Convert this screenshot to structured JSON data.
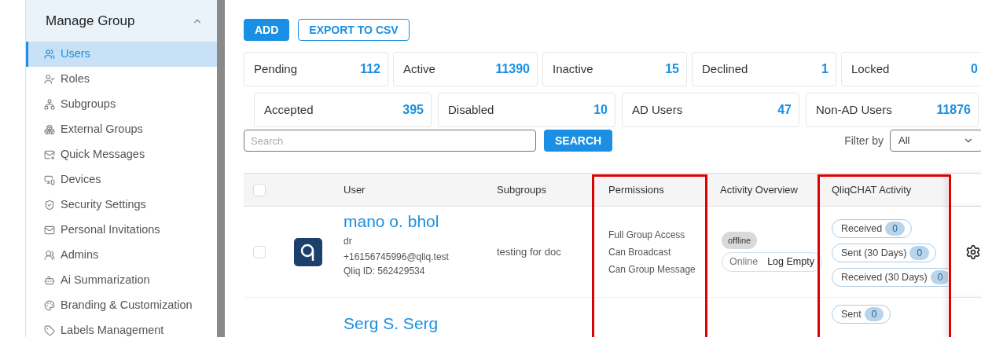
{
  "sidebar": {
    "title": "Manage Group",
    "expanded": true,
    "items": [
      {
        "label": "Users",
        "selected": true
      },
      {
        "label": "Roles",
        "selected": false
      },
      {
        "label": "Subgroups",
        "selected": false
      },
      {
        "label": "External Groups",
        "selected": false
      },
      {
        "label": "Quick Messages",
        "selected": false
      },
      {
        "label": "Devices",
        "selected": false
      },
      {
        "label": "Security Settings",
        "selected": false
      },
      {
        "label": "Personal Invitations",
        "selected": false
      },
      {
        "label": "Admins",
        "selected": false
      },
      {
        "label": "Ai Summarization",
        "selected": false
      },
      {
        "label": "Branding & Customization",
        "selected": false
      },
      {
        "label": "Labels Management",
        "selected": false
      }
    ]
  },
  "actions": {
    "add": "ADD",
    "export": "EXPORT TO CSV"
  },
  "stats_row_1": [
    {
      "label": "Pending",
      "count": "112"
    },
    {
      "label": "Active",
      "count": "11390"
    },
    {
      "label": "Inactive",
      "count": "15"
    },
    {
      "label": "Declined",
      "count": "1"
    },
    {
      "label": "Locked",
      "count": "0"
    }
  ],
  "stats_row_2": [
    {
      "label": "Accepted",
      "count": "395"
    },
    {
      "label": "Disabled",
      "count": "10"
    },
    {
      "label": "AD Users",
      "count": "47"
    },
    {
      "label": "Non-AD Users",
      "count": "11876"
    }
  ],
  "search": {
    "placeholder": "Search",
    "button": "SEARCH"
  },
  "filter": {
    "label": "Filter by",
    "value": "All"
  },
  "table": {
    "select_all_checked": false,
    "columns": [
      "User",
      "Subgroups",
      "Permissions",
      "Activity Overview",
      "QliqCHAT Activity"
    ],
    "rows": [
      {
        "name": "mano o. bhol",
        "title": "dr",
        "email": "+16156745996@qliq.test",
        "qliq_id": "Qliq ID: 562429534",
        "subgroups": "testing for doc",
        "permissions": [
          "Full Group Access",
          "Can Broadcast",
          "Can Group Message"
        ],
        "status": "offline",
        "presence": "Online",
        "log": "Log Empty",
        "activity": [
          {
            "label": "Received",
            "count": "0"
          },
          {
            "label": "Sent (30 Days)",
            "count": "0"
          },
          {
            "label": "Received (30 Days)",
            "count": "0"
          }
        ],
        "checked": false
      },
      {
        "name": "Serg S. Serg",
        "activity": [
          {
            "label": "Sent",
            "count": "0"
          }
        ]
      }
    ]
  }
}
